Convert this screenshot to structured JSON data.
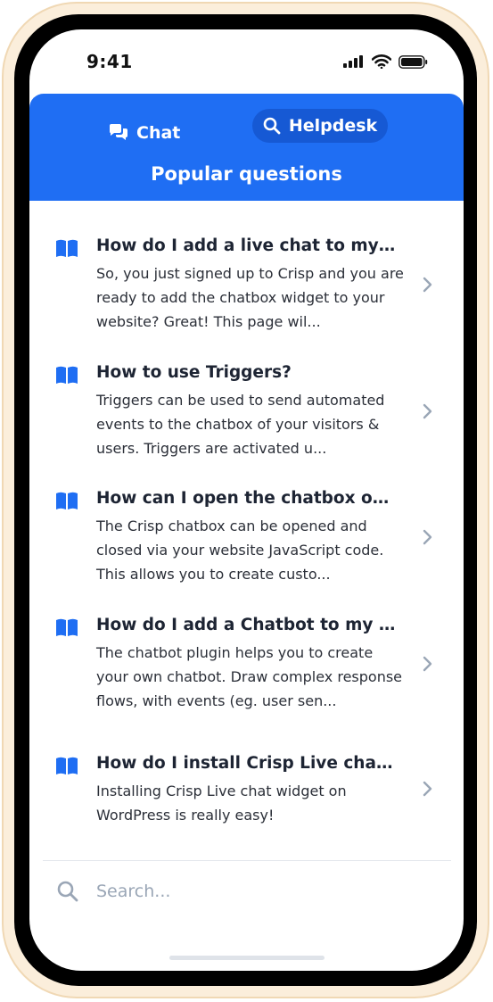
{
  "status_bar": {
    "time": "9:41",
    "icons": [
      "signal-icon",
      "wifi-icon",
      "battery-icon"
    ]
  },
  "header": {
    "tabs": [
      {
        "label": "Chat",
        "icon": "chat-bubbles-icon",
        "active": false
      },
      {
        "label": "Helpdesk",
        "icon": "search-icon",
        "active": true
      }
    ],
    "title": "Popular questions"
  },
  "articles": [
    {
      "title": "How do I add a live chat to my we...",
      "description": "So, you just signed up to Crisp and you are ready to add the chatbox widget to your website? Great! This page wil...",
      "icon": "book-icon"
    },
    {
      "title": "How to use Triggers?",
      "description": "Triggers can be used to send automated events to the chatbox of your visitors & users. Triggers are activated u...",
      "icon": "book-icon"
    },
    {
      "title": "How can I open the chatbox on cli...",
      "description": "The Crisp chatbox can be opened and closed via your website JavaScript code. This allows you to create custo...",
      "icon": "book-icon"
    },
    {
      "title": "How do I add a Chatbot to my we...",
      "description": "The chatbot plugin helps you to create your own chatbot. Draw complex response flows, with events (eg. user sen...",
      "icon": "book-icon"
    },
    {
      "title": "How do I install Crisp Live chat...",
      "description": "Installing Crisp Live chat widget on WordPress is really easy!",
      "icon": "book-icon"
    }
  ],
  "search": {
    "placeholder": "Search...",
    "value": ""
  },
  "colors": {
    "brand_blue": "#1f6ef3",
    "active_tab": "#1659d4",
    "frame": "#fbeedb"
  }
}
